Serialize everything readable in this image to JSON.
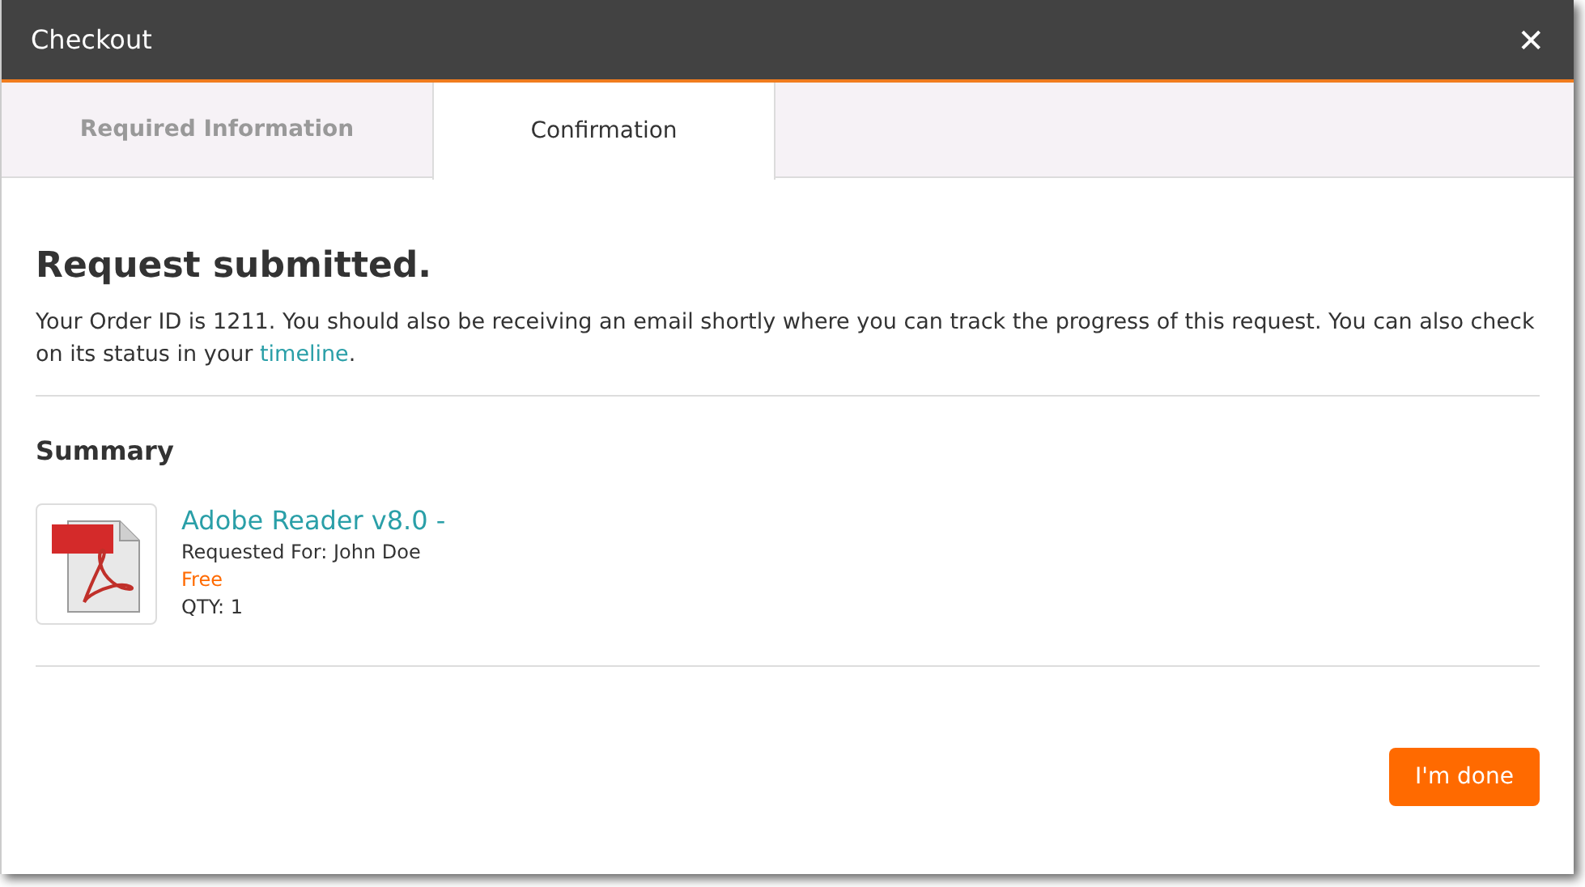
{
  "window": {
    "title": "Checkout",
    "close": "✕"
  },
  "tabs": [
    {
      "label": "Required Information",
      "selected": false
    },
    {
      "label": "Confirmation",
      "selected": true
    }
  ],
  "heading": "Request submitted.",
  "message": {
    "text": "Your Order ID is 1211. You should also be receiving an email shortly where you can track the progress of this request. You can also check on its status in your ",
    "link": "timeline",
    "end": "."
  },
  "summary": {
    "title": "Summary",
    "items": [
      {
        "name": "Adobe Reader v8.0 -",
        "requested_for": "Requested For: John Doe",
        "price": "Free",
        "qty": "QTY: 1"
      }
    ]
  },
  "buttons": [
    {
      "label": "I'm done"
    }
  ]
}
